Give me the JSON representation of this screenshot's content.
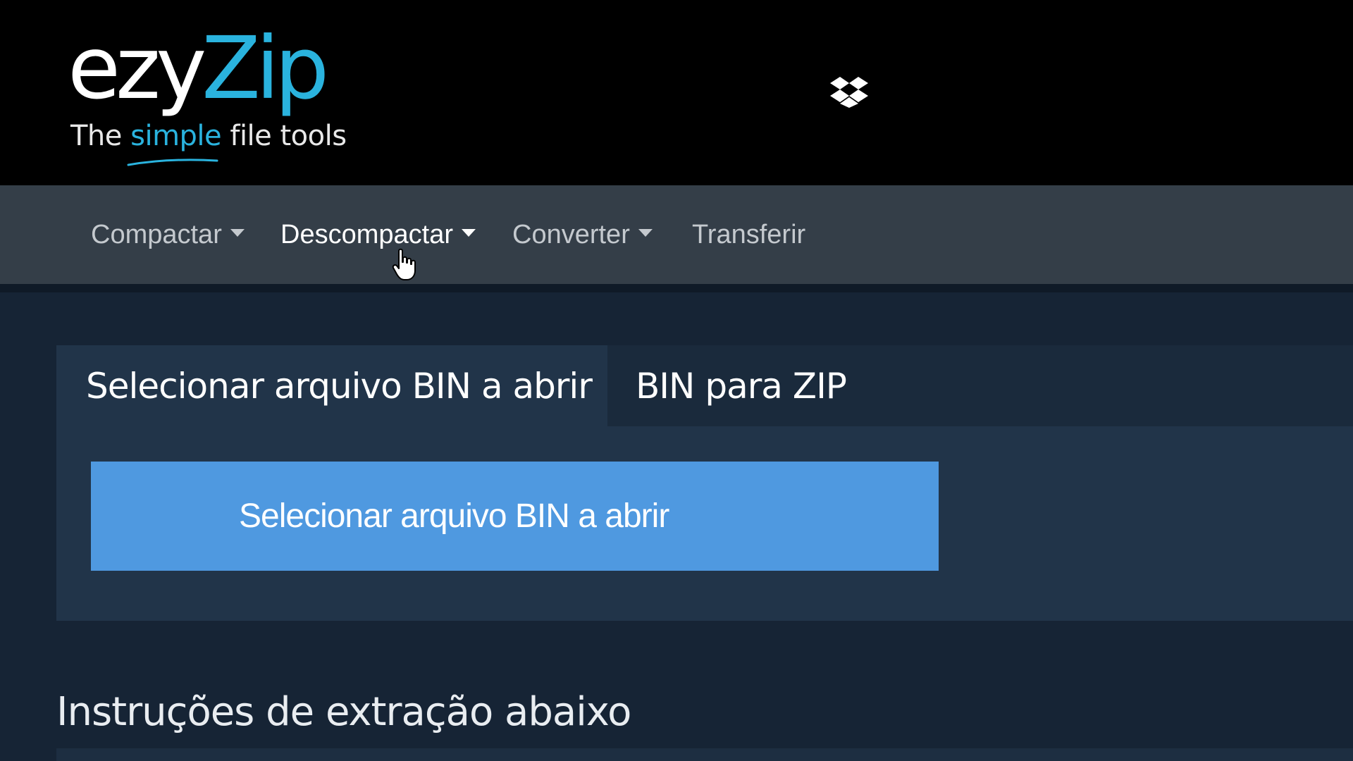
{
  "brand": {
    "logo_part1": "ezy",
    "logo_part2": "Zip",
    "tagline_before": "The ",
    "tagline_highlight": "simple",
    "tagline_after": " file tools",
    "accent_color": "#2ab3de"
  },
  "nav": {
    "items": [
      {
        "label": "Compactar",
        "has_dropdown": true
      },
      {
        "label": "Descompactar",
        "has_dropdown": true,
        "active": true
      },
      {
        "label": "Converter",
        "has_dropdown": true
      },
      {
        "label": "Transferir",
        "has_dropdown": false
      }
    ]
  },
  "tabs": [
    {
      "label": "Selecionar arquivo BIN a abrir",
      "active": true
    },
    {
      "label": "BIN para ZIP",
      "active": false
    }
  ],
  "panel": {
    "select_button_label": "Selecionar arquivo BIN a abrir",
    "dropbox_icon": "dropbox-icon",
    "button_color": "#4f99e0"
  },
  "instructions_heading": "Instruções de extração abaixo"
}
